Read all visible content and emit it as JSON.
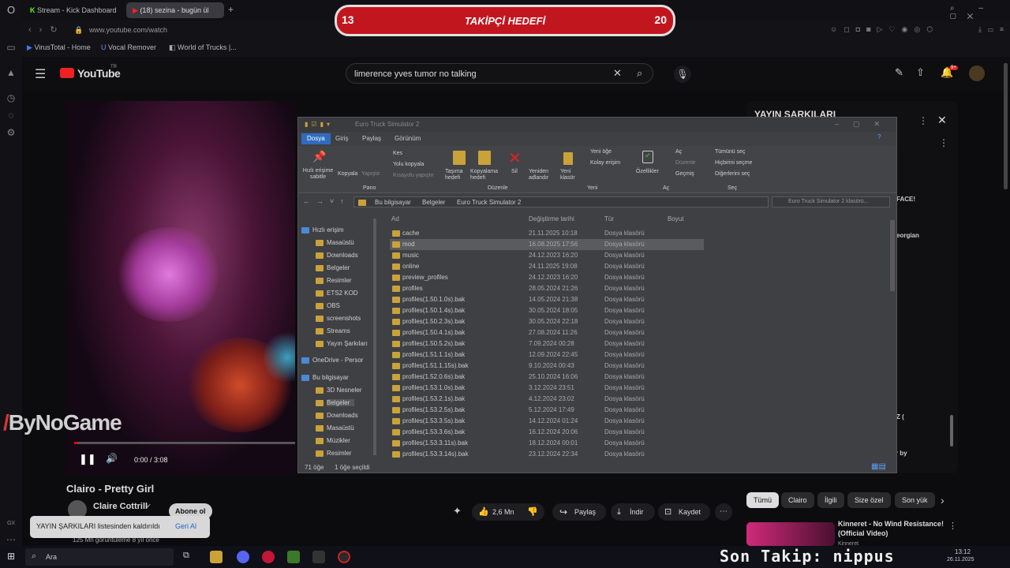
{
  "tabs": {
    "t1": "Stream - Kick Dashboard",
    "t2": "(18) sezina - bugün ül"
  },
  "address": "www.youtube.com/watch",
  "bookmarks": [
    "VirusTotal - Home",
    "Vocal Remover",
    "World of Trucks |..."
  ],
  "overlay": {
    "left_num": "13",
    "title": "TAKİPÇİ HEDEFİ",
    "right_num": "20"
  },
  "youtube": {
    "logo": "YouTube",
    "country": "TR",
    "search": "limerence yves tumor no talking",
    "badge": "9+"
  },
  "player": {
    "time": "0:00 / 3:08",
    "watermark": "ByNoGame"
  },
  "video": {
    "title": "Clairo - Pretty Girl",
    "channel": "Claire Cottrill",
    "subscribe": "Abone ol",
    "views": "125 Mn görüntüleme  8 yıl önce"
  },
  "actions": {
    "likes": "2,6 Mn",
    "share": "Paylaş",
    "download": "İndir",
    "save": "Kaydet"
  },
  "toast": {
    "text": "YAYIN ŞARKILARI listesinden kaldırıldı",
    "undo": "Geri Al"
  },
  "playlist": {
    "title": "YAYIN ŞARKILARI",
    "frag1": "FACE!",
    "frag2": "eorgian",
    "frag3": "Z (",
    "frag4": "ver by"
  },
  "chips": [
    "Tümü",
    "Clairo",
    "İlgili",
    "Size özel",
    "Son yük"
  ],
  "rec": {
    "title": "Kinneret - No Wind Resistance! (Official Video)",
    "channel": "Kinneret"
  },
  "explorer": {
    "title": "Euro Truck Simulator 2",
    "ribbon_tabs": [
      "Dosya",
      "Giriş",
      "Paylaş",
      "Görünüm"
    ],
    "ribbon": {
      "pin": "Hızlı erişime sabitle",
      "copy": "Kopyala",
      "paste": "Yapıştır",
      "cut": "Kes",
      "copypath": "Yolu kopyala",
      "paste_sc": "Kısayolu yapıştır",
      "move": "Taşıma hedefi",
      "copyto": "Kopyalama hedefi",
      "delete": "Sil",
      "rename": "Yeniden adlandır",
      "newfolder": "Yeni klasör",
      "newitem": "Yeni öğe",
      "easy": "Kolay erişim",
      "props": "Özellikler",
      "open": "Aç",
      "edit": "Düzenle",
      "history": "Geçmiş",
      "selall": "Tümünü seç",
      "selnone": "Hiçbirini seçme",
      "invert": "Diğerlerini seç",
      "g_pano": "Pano",
      "g_duzen": "Düzenle",
      "g_yeni": "Yeni",
      "g_ac": "Aç",
      "g_sec": "Seç"
    },
    "path": [
      "Bu bilgisayar",
      "Belgeler",
      "Euro Truck Simulator 2"
    ],
    "search_ph": "Euro Truck Simulator 2 klasörü...",
    "cols": [
      "Ad",
      "Değiştirme tarihi",
      "Tür",
      "Boyut"
    ],
    "nav": [
      "Hızlı erişim",
      "Masaüstü",
      "Downloads",
      "Belgeler",
      "Resimler",
      "ETS2 KOD",
      "OBS",
      "screenshots",
      "Streams",
      "Yayın Şarkıları",
      "OneDrive - Persor",
      "Bu bilgisayar",
      "3D Nesneler",
      "Belgeler",
      "Downloads",
      "Masaüstü",
      "Müzikler",
      "Resimler"
    ],
    "files": [
      [
        "cache",
        "21.11.2025 10:18"
      ],
      [
        "mod",
        "16.08.2025 17:56"
      ],
      [
        "music",
        "24.12.2023 16:20"
      ],
      [
        "online",
        "24.11.2025 19:08"
      ],
      [
        "preview_profiles",
        "24.12.2023 16:20"
      ],
      [
        "profiles",
        "28.05.2024 21:26"
      ],
      [
        "profiles(1.50.1.0s).bak",
        "14.05.2024 21:38"
      ],
      [
        "profiles(1.50.1.4s).bak",
        "30.05.2024 18:05"
      ],
      [
        "profiles(1.50.2.3s).bak",
        "30.05.2024 22:18"
      ],
      [
        "profiles(1.50.4.1s).bak",
        "27.08.2024 11:26"
      ],
      [
        "profiles(1.50.5.2s).bak",
        "7.09.2024 00:28"
      ],
      [
        "profiles(1.51.1.1s).bak",
        "12.09.2024 22:45"
      ],
      [
        "profiles(1.51.1.15s).bak",
        "9.10.2024 00:43"
      ],
      [
        "profiles(1.52.0.6s).bak",
        "25.10.2024 16:06"
      ],
      [
        "profiles(1.53.1.0s).bak",
        "3.12.2024 23:51"
      ],
      [
        "profiles(1.53.2.1s).bak",
        "4.12.2024 23:02"
      ],
      [
        "profiles(1.53.2.5s).bak",
        "5.12.2024 17:49"
      ],
      [
        "profiles(1.53.3.5s).bak",
        "14.12.2024 01:24"
      ],
      [
        "profiles(1.53.3.6s).bak",
        "16.12.2024 20:06"
      ],
      [
        "profiles(1.53.3.11s).bak",
        "18.12.2024 00:01"
      ],
      [
        "profiles(1.53.3.14s).bak",
        "23.12.2024 22:34"
      ]
    ],
    "type": "Dosya klasörü",
    "status_count": "71 öğe",
    "status_sel": "1 öğe seçildi"
  },
  "taskbar": {
    "search": "Ara",
    "ticker": "Son Takip: nippus",
    "time": "13:12",
    "date": "26.11.2025",
    "gx": "GX"
  }
}
